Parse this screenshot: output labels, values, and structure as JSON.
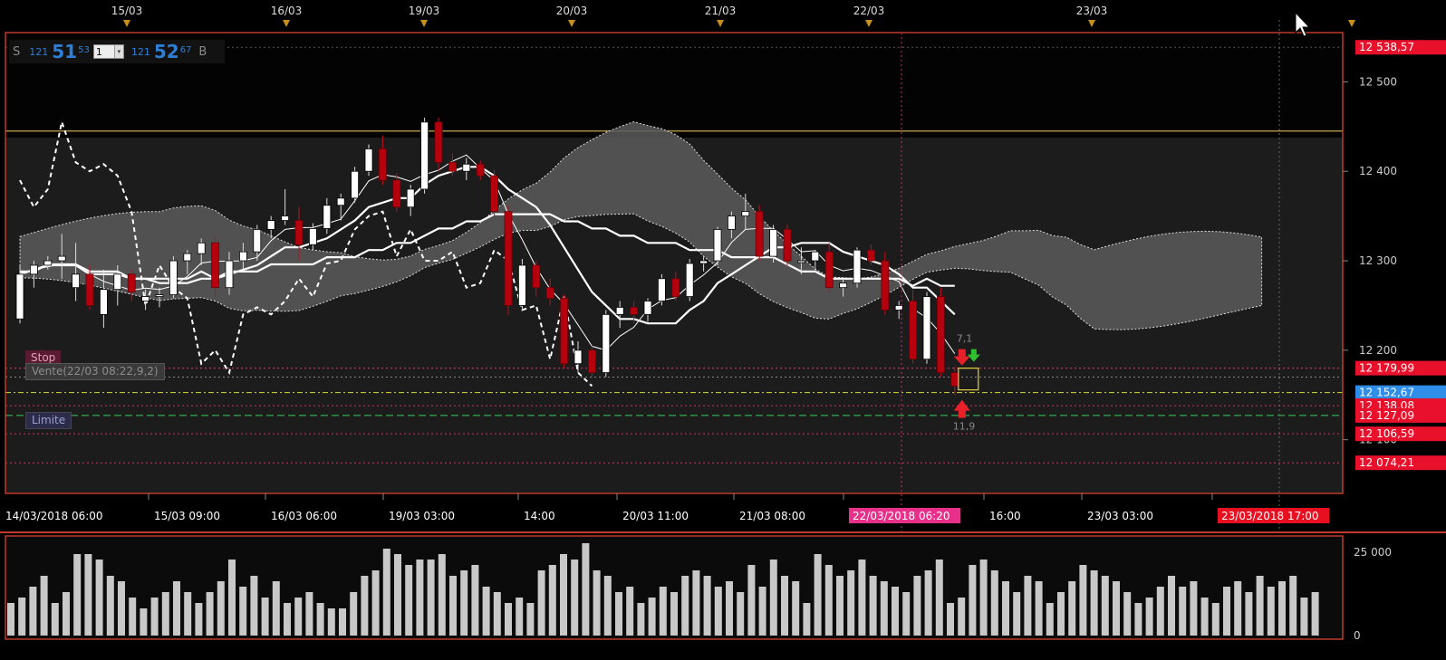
{
  "trade_panel": {
    "sell_label": "S",
    "sell_prefix": "121",
    "sell_big": "51",
    "sell_sup": "53",
    "quantity": "1",
    "buy_prefix": "121",
    "buy_big": "52",
    "buy_sup": "67",
    "buy_label": "B"
  },
  "orders": {
    "stop_label": "Stop",
    "vente_label": "Vente(22/03 08:22,9,2)",
    "limite_label": "Limite"
  },
  "annotations": {
    "upper": "7,1",
    "lower": "11,9"
  },
  "top_dates": [
    "15/03",
    "16/03",
    "19/03",
    "20/03",
    "21/03",
    "22/03",
    "23/03"
  ],
  "time_labels": [
    "14/03/2018 06:00",
    "15/03 09:00",
    "16/03 06:00",
    "19/03 03:00",
    "14:00",
    "20/03 11:00",
    "21/03 08:00",
    "22/03/2018 06:20",
    "16:00",
    "23/03 03:00",
    "23/03/2018 17:00"
  ],
  "price_labels": {
    "ticks": [
      "12 500",
      "12 400",
      "12 300",
      "12 200",
      "12 100"
    ],
    "highlights": [
      {
        "text": "12 538,57",
        "price": 12538.57,
        "color": "#e8102a"
      },
      {
        "text": "12 179,99",
        "price": 12179.99,
        "color": "#e8102a"
      },
      {
        "text": "12 152,67",
        "price": 12152.67,
        "color": "#2f8ee8"
      },
      {
        "text": "12 138,08",
        "price": 12138.08,
        "color": "#e8102a"
      },
      {
        "text": "12 127,09",
        "price": 12127.09,
        "color": "#e8102a"
      },
      {
        "text": "12 106,59",
        "price": 12106.59,
        "color": "#e8102a"
      },
      {
        "text": "12 074,21",
        "price": 12074.21,
        "color": "#e8102a"
      }
    ]
  },
  "volume_ticks": [
    "25 000",
    "0"
  ],
  "colors": {
    "background": "#000000",
    "plot_background": "#1a1a1a",
    "frame": "#c0392b",
    "bull_candle": "#ffffff",
    "bear_candle": "#b5000e",
    "cloud": "#5a5a5a",
    "volume": "#c8c8c8"
  },
  "chart_data": {
    "type": "candlestick",
    "ylim": [
      12040,
      12555
    ],
    "horizontal_levels": [
      {
        "price": 12445,
        "kind": "resistance"
      },
      {
        "price": 12538.57,
        "kind": "high"
      },
      {
        "price": 12179.99,
        "kind": "stop"
      },
      {
        "price": 12170,
        "kind": "vente"
      },
      {
        "price": 12152.67,
        "kind": "current"
      },
      {
        "price": 12138.08,
        "kind": "level"
      },
      {
        "price": 12127.09,
        "kind": "limite"
      },
      {
        "price": 12106.59,
        "kind": "level"
      },
      {
        "price": 12074.21,
        "kind": "level"
      }
    ],
    "candles": [
      [
        12235,
        12295,
        12230,
        12285
      ],
      [
        12285,
        12300,
        12270,
        12295
      ],
      [
        12295,
        12305,
        12290,
        12300
      ],
      [
        12300,
        12330,
        12280,
        12305
      ],
      [
        12270,
        12320,
        12255,
        12285
      ],
      [
        12285,
        12295,
        12245,
        12250
      ],
      [
        12240,
        12290,
        12225,
        12268
      ],
      [
        12268,
        12295,
        12250,
        12285
      ],
      [
        12285,
        12290,
        12255,
        12265
      ],
      [
        12255,
        12268,
        12245,
        12260
      ],
      [
        12260,
        12270,
        12248,
        12262
      ],
      [
        12262,
        12305,
        12258,
        12300
      ],
      [
        12300,
        12312,
        12285,
        12308
      ],
      [
        12308,
        12325,
        12295,
        12320
      ],
      [
        12320,
        12328,
        12260,
        12270
      ],
      [
        12270,
        12310,
        12262,
        12300
      ],
      [
        12300,
        12320,
        12290,
        12310
      ],
      [
        12310,
        12340,
        12300,
        12335
      ],
      [
        12335,
        12350,
        12325,
        12345
      ],
      [
        12345,
        12380,
        12340,
        12350
      ],
      [
        12345,
        12360,
        12300,
        12318
      ],
      [
        12318,
        12342,
        12312,
        12336
      ],
      [
        12336,
        12370,
        12330,
        12362
      ],
      [
        12362,
        12375,
        12345,
        12370
      ],
      [
        12370,
        12405,
        12365,
        12400
      ],
      [
        12400,
        12430,
        12395,
        12425
      ],
      [
        12425,
        12440,
        12385,
        12390
      ],
      [
        12390,
        12398,
        12355,
        12360
      ],
      [
        12360,
        12385,
        12350,
        12380
      ],
      [
        12380,
        12460,
        12375,
        12455
      ],
      [
        12455,
        12460,
        12400,
        12410
      ],
      [
        12410,
        12420,
        12395,
        12400
      ],
      [
        12400,
        12415,
        12390,
        12408
      ],
      [
        12408,
        12412,
        12390,
        12395
      ],
      [
        12395,
        12402,
        12350,
        12355
      ],
      [
        12355,
        12362,
        12240,
        12250
      ],
      [
        12250,
        12302,
        12245,
        12295
      ],
      [
        12295,
        12300,
        12260,
        12270
      ],
      [
        12270,
        12280,
        12250,
        12258
      ],
      [
        12258,
        12262,
        12180,
        12185
      ],
      [
        12185,
        12210,
        12175,
        12200
      ],
      [
        12200,
        12205,
        12170,
        12175
      ],
      [
        12175,
        12245,
        12170,
        12240
      ],
      [
        12240,
        12255,
        12225,
        12248
      ],
      [
        12248,
        12255,
        12230,
        12240
      ],
      [
        12240,
        12258,
        12232,
        12255
      ],
      [
        12255,
        12285,
        12250,
        12280
      ],
      [
        12280,
        12288,
        12255,
        12260
      ],
      [
        12260,
        12302,
        12255,
        12297
      ],
      [
        12297,
        12305,
        12288,
        12300
      ],
      [
        12300,
        12338,
        12295,
        12335
      ],
      [
        12335,
        12355,
        12325,
        12350
      ],
      [
        12350,
        12375,
        12335,
        12355
      ],
      [
        12355,
        12362,
        12300,
        12305
      ],
      [
        12305,
        12340,
        12298,
        12335
      ],
      [
        12335,
        12340,
        12295,
        12300
      ],
      [
        12300,
        12315,
        12285,
        12300
      ],
      [
        12300,
        12312,
        12290,
        12310
      ],
      [
        12310,
        12320,
        12265,
        12270
      ],
      [
        12270,
        12280,
        12260,
        12275
      ],
      [
        12275,
        12315,
        12270,
        12312
      ],
      [
        12312,
        12318,
        12295,
        12300
      ],
      [
        12300,
        12310,
        12240,
        12245
      ],
      [
        12245,
        12255,
        12235,
        12250
      ],
      [
        12255,
        12268,
        12185,
        12190
      ],
      [
        12190,
        12265,
        12185,
        12260
      ],
      [
        12260,
        12270,
        12170,
        12175
      ],
      [
        12175,
        12182,
        12150,
        12160
      ]
    ],
    "volume": [
      12,
      14,
      18,
      22,
      12,
      16,
      30,
      30,
      28,
      22,
      20,
      14,
      10,
      14,
      16,
      20,
      16,
      12,
      16,
      20,
      28,
      18,
      22,
      14,
      20,
      12,
      14,
      16,
      12,
      10,
      10,
      16,
      22,
      24,
      32,
      30,
      26,
      28,
      28,
      30,
      22,
      24,
      26,
      18,
      16,
      12,
      14,
      12,
      24,
      26,
      30,
      28,
      34,
      24,
      22,
      16,
      18,
      12,
      14,
      18,
      16,
      22,
      24,
      22,
      18,
      20,
      16,
      26,
      18,
      28,
      22,
      20,
      12,
      30,
      26,
      22,
      24,
      28,
      22,
      20,
      18,
      16,
      22,
      24,
      28,
      12,
      14,
      26,
      28,
      24,
      20,
      16,
      22,
      20,
      12,
      16,
      20,
      26,
      24,
      22,
      20,
      16,
      12,
      14,
      18,
      22,
      18,
      20,
      14,
      12,
      18,
      20,
      16,
      22,
      18,
      20,
      22,
      14,
      16
    ],
    "volume_ylim": [
      0,
      27000
    ]
  }
}
